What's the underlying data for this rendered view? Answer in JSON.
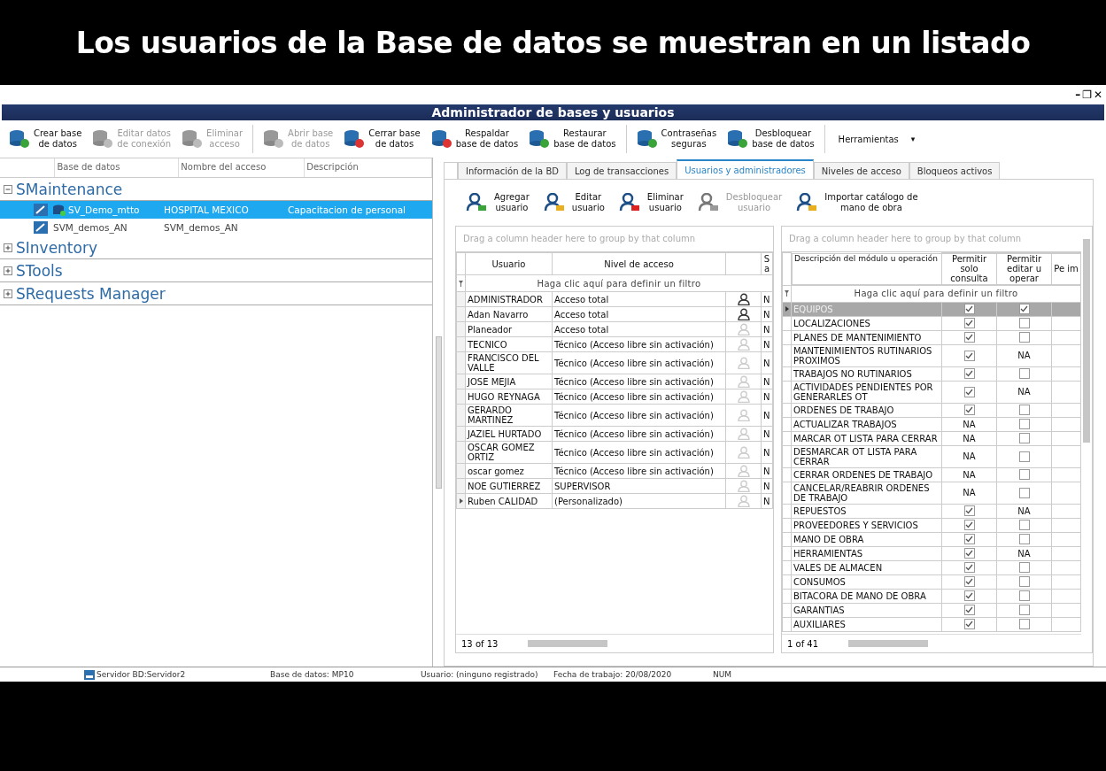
{
  "caption": "Los usuarios de la Base de datos se muestran en un listado",
  "window": {
    "title": "Administrador de bases y usuarios",
    "controls": [
      "–",
      "❐",
      "✕"
    ]
  },
  "toolbar": [
    {
      "lines": [
        "Crear base",
        "de datos"
      ],
      "disabled": false
    },
    {
      "lines": [
        "Editar datos",
        "de conexión"
      ],
      "disabled": true
    },
    {
      "lines": [
        "Eliminar",
        "acceso"
      ],
      "disabled": true
    },
    {
      "lines": [
        "Abrir base",
        "de datos"
      ],
      "disabled": true
    },
    {
      "lines": [
        "Cerrar base",
        "de datos"
      ],
      "disabled": false
    },
    {
      "lines": [
        "Respaldar",
        "base de datos"
      ],
      "disabled": false
    },
    {
      "lines": [
        "Restaurar",
        "base de datos"
      ],
      "disabled": false
    },
    {
      "lines": [
        "Contraseñas",
        "seguras"
      ],
      "disabled": false
    },
    {
      "lines": [
        "Desbloquear",
        "base de datos"
      ],
      "disabled": false
    }
  ],
  "tools_menu": {
    "label": "Herramientas",
    "caret": "▾"
  },
  "tree": {
    "columns": [
      "Base de datos",
      "Nombre del acceso",
      "Descripción"
    ],
    "groups": [
      {
        "name": "SMaintenance",
        "expanded": true,
        "children": [
          {
            "database": "SV_Demo_mtto",
            "access": "HOSPITAL MEXICO",
            "description": "Capacitacion de personal",
            "selected": true
          },
          {
            "database": "SVM_demos_AN",
            "access": "SVM_demos_AN",
            "selected": false
          }
        ]
      },
      {
        "name": "SInventory",
        "expanded": false
      },
      {
        "name": "STools",
        "expanded": false
      },
      {
        "name": "SRequests Manager",
        "expanded": false
      }
    ]
  },
  "tabs": [
    {
      "label": "Información de la BD",
      "selected": false
    },
    {
      "label": "Log de transacciones",
      "selected": false
    },
    {
      "label": "Usuarios y administradores",
      "selected": true
    },
    {
      "label": "Niveles de acceso",
      "selected": false
    },
    {
      "label": "Bloqueos activos",
      "selected": false
    }
  ],
  "user_actions": [
    {
      "lines": [
        "Agregar",
        "usuario"
      ],
      "disabled": false
    },
    {
      "lines": [
        "Editar",
        "usuario"
      ],
      "disabled": false
    },
    {
      "lines": [
        "Eliminar",
        "usuario"
      ],
      "disabled": false
    },
    {
      "lines": [
        "Desbloquear",
        "usuario"
      ],
      "disabled": true
    },
    {
      "lines": [
        "Importar catálogo de",
        "mano de obra"
      ],
      "disabled": false
    }
  ],
  "users_grid": {
    "group_hint": "Drag a column header here to group by that column",
    "columns": [
      "Usuario",
      "Nivel de acceso",
      "",
      "S a"
    ],
    "filter_hint": "Haga clic aquí para definir un filtro",
    "footer": "13 of 13",
    "rows": [
      {
        "user": "ADMINISTRADOR",
        "level": "Acceso total",
        "admin": true,
        "column_4": "N",
        "current": false
      },
      {
        "user": "Adan Navarro",
        "level": "Acceso total",
        "admin": true,
        "column_4": "N",
        "current": false
      },
      {
        "user": "Planeador",
        "level": "Acceso total",
        "admin": false,
        "column_4": "N",
        "current": false
      },
      {
        "user": "TECNICO",
        "level": "Técnico (Acceso libre sin activación)",
        "admin": false,
        "column_4": "N",
        "current": false
      },
      {
        "user": "FRANCISCO DEL VALLE",
        "level": "Técnico (Acceso libre sin activación)",
        "admin": false,
        "column_4": "N",
        "current": false
      },
      {
        "user": "JOSE MEJIA",
        "level": "Técnico (Acceso libre sin activación)",
        "admin": false,
        "column_4": "N",
        "current": false
      },
      {
        "user": "HUGO REYNAGA",
        "level": "Técnico (Acceso libre sin activación)",
        "admin": false,
        "column_4": "N",
        "current": false
      },
      {
        "user": "GERARDO MARTINEZ",
        "level": "Técnico (Acceso libre sin activación)",
        "admin": false,
        "column_4": "N",
        "current": false
      },
      {
        "user": "JAZIEL HURTADO",
        "level": "Técnico (Acceso libre sin activación)",
        "admin": false,
        "column_4": "N",
        "current": false
      },
      {
        "user": "OSCAR GOMEZ ORTIZ",
        "level": "Técnico (Acceso libre sin activación)",
        "admin": false,
        "column_4": "N",
        "current": false
      },
      {
        "user": "oscar gomez",
        "level": "Técnico (Acceso libre sin activación)",
        "admin": false,
        "column_4": "N",
        "current": false
      },
      {
        "user": "NOE GUTIERREZ",
        "level": "SUPERVISOR",
        "admin": false,
        "column_4": "N",
        "current": false
      },
      {
        "user": "Ruben CALIDAD",
        "level": "(Personalizado)",
        "admin": false,
        "column_4": "N",
        "current": true
      }
    ]
  },
  "permissions_grid": {
    "group_hint": "Drag a column header here to group by that column",
    "columns": [
      "Descripción del módulo u operación",
      "Permitir solo consulta",
      "Permitir editar u operar",
      "Pe im"
    ],
    "filter_hint": "Haga clic aquí para definir un filtro",
    "footer": "1 of 41",
    "rows": [
      {
        "module": "EQUIPOS",
        "selected": true,
        "view": {
          "kind": "check",
          "checked": true
        },
        "edit": {
          "kind": "check",
          "checked": true
        }
      },
      {
        "module": "LOCALIZACIONES",
        "selected": false,
        "view": {
          "kind": "check",
          "checked": true
        },
        "edit": {
          "kind": "check",
          "checked": false
        }
      },
      {
        "module": "PLANES DE MANTENIMIENTO",
        "selected": false,
        "view": {
          "kind": "check",
          "checked": true
        },
        "edit": {
          "kind": "check",
          "checked": false
        }
      },
      {
        "module": "MANTENIMIENTOS RUTINARIOS PROXIMOS",
        "selected": false,
        "view": {
          "kind": "check",
          "checked": true
        },
        "edit": {
          "kind": "text",
          "text": "NA"
        }
      },
      {
        "module": "TRABAJOS NO RUTINARIOS",
        "selected": false,
        "view": {
          "kind": "check",
          "checked": true
        },
        "edit": {
          "kind": "check",
          "checked": false
        }
      },
      {
        "module": "ACTIVIDADES PENDIENTES POR GENERARLES OT",
        "selected": false,
        "view": {
          "kind": "check",
          "checked": true
        },
        "edit": {
          "kind": "text",
          "text": "NA"
        }
      },
      {
        "module": "ORDENES DE TRABAJO",
        "selected": false,
        "view": {
          "kind": "check",
          "checked": true
        },
        "edit": {
          "kind": "check",
          "checked": false
        }
      },
      {
        "module": "ACTUALIZAR TRABAJOS",
        "selected": false,
        "view": {
          "kind": "text",
          "text": "NA"
        },
        "edit": {
          "kind": "check",
          "checked": false
        }
      },
      {
        "module": "MARCAR OT LISTA PARA CERRAR",
        "selected": false,
        "view": {
          "kind": "text",
          "text": "NA"
        },
        "edit": {
          "kind": "check",
          "checked": false
        }
      },
      {
        "module": "DESMARCAR OT LISTA PARA CERRAR",
        "selected": false,
        "view": {
          "kind": "text",
          "text": "NA"
        },
        "edit": {
          "kind": "check",
          "checked": false
        }
      },
      {
        "module": "CERRAR ORDENES DE TRABAJO",
        "selected": false,
        "view": {
          "kind": "text",
          "text": "NA"
        },
        "edit": {
          "kind": "check",
          "checked": false
        }
      },
      {
        "module": "CANCELAR/REABRIR ORDENES DE TRABAJO",
        "selected": false,
        "view": {
          "kind": "text",
          "text": "NA"
        },
        "edit": {
          "kind": "check",
          "checked": false
        }
      },
      {
        "module": "REPUESTOS",
        "selected": false,
        "view": {
          "kind": "check",
          "checked": true
        },
        "edit": {
          "kind": "text",
          "text": "NA"
        }
      },
      {
        "module": "PROVEEDORES Y SERVICIOS",
        "selected": false,
        "view": {
          "kind": "check",
          "checked": true
        },
        "edit": {
          "kind": "check",
          "checked": false
        }
      },
      {
        "module": "MANO DE OBRA",
        "selected": false,
        "view": {
          "kind": "check",
          "checked": true
        },
        "edit": {
          "kind": "check",
          "checked": false
        }
      },
      {
        "module": "HERRAMIENTAS",
        "selected": false,
        "view": {
          "kind": "check",
          "checked": true
        },
        "edit": {
          "kind": "text",
          "text": "NA"
        }
      },
      {
        "module": "VALES DE ALMACEN",
        "selected": false,
        "view": {
          "kind": "check",
          "checked": true
        },
        "edit": {
          "kind": "check",
          "checked": false
        }
      },
      {
        "module": "CONSUMOS",
        "selected": false,
        "view": {
          "kind": "check",
          "checked": true
        },
        "edit": {
          "kind": "check",
          "checked": false
        }
      },
      {
        "module": "BITACORA DE MANO DE OBRA",
        "selected": false,
        "view": {
          "kind": "check",
          "checked": true
        },
        "edit": {
          "kind": "check",
          "checked": false
        }
      },
      {
        "module": "GARANTIAS",
        "selected": false,
        "view": {
          "kind": "check",
          "checked": true
        },
        "edit": {
          "kind": "check",
          "checked": false
        }
      },
      {
        "module": "AUXILIARES",
        "selected": false,
        "view": {
          "kind": "check",
          "checked": true
        },
        "edit": {
          "kind": "check",
          "checked": false
        }
      }
    ]
  },
  "status_bar": [
    "Servidor BD:Servidor2",
    "Base de datos: MP10",
    "Usuario: (ninguno registrado)",
    "Fecha de trabajo: 20/08/2020",
    "NUM"
  ]
}
